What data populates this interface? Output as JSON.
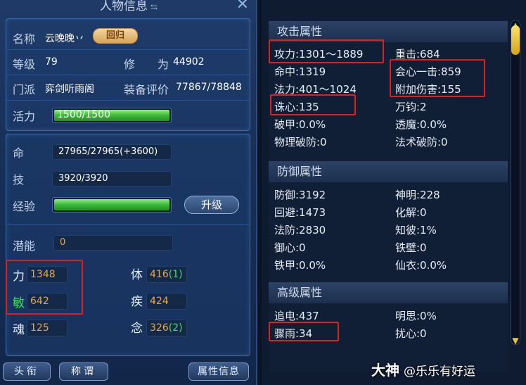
{
  "left": {
    "title": "人物信息",
    "name_label": "名称",
    "name_value": "云晚晚丷",
    "badge_text": "回归",
    "level_label": "等级",
    "level_value": "79",
    "cultivation_label": "修",
    "cultivation_label2": "为",
    "cultivation_value": "44902",
    "sect_label": "门派",
    "sect_value": "弈剑听雨阁",
    "rating_label": "装备评价",
    "rating_value": "77867/78848",
    "vitality_label": "活力",
    "vitality_value": "1500/1500",
    "vitality_fill": 1.0,
    "life_label": "命",
    "life_value": "27965/27965(+3600)",
    "skill_label": "技",
    "skill_value": "3920/3920",
    "exp_label": "经验",
    "exp_fill": 1.0,
    "upgrade_label": "升级",
    "potential_label": "潜能",
    "potential_value": "0",
    "attrs": {
      "li_label": "力",
      "li_value": "1348",
      "ti_label": "体",
      "ti_value": "416",
      "ti_bonus": "(1)",
      "min_label": "敏",
      "min_value": "642",
      "ji_label": "疾",
      "ji_value": "424",
      "hun_label": "魂",
      "hun_value": "125",
      "nian_label": "念",
      "nian_value": "326",
      "nian_bonus": "(2)"
    },
    "buttons": {
      "title_btn": "头衔",
      "appellation_btn": "称谓",
      "attr_info_btn": "属性信息"
    }
  },
  "right": {
    "attack_header": "攻击属性",
    "attack": {
      "atk": "攻力:1301～1889",
      "heavy": "重击:684",
      "hit": "命中:1319",
      "crit": "会心一击:859",
      "mag": "法力:401～1024",
      "extra_dmg": "附加伤害:155",
      "zhuxin": "诛心:135",
      "wanjun": "万钧:2",
      "pojia": "破甲:0.0%",
      "touomo": "透魔:0.0%",
      "phys_pen": "物理破防:0",
      "mag_pen": "法术破防:0"
    },
    "defense_header": "防御属性",
    "defense": {
      "def": "防御:3192",
      "shenming": "神明:228",
      "dodge": "回避:1473",
      "huajie": "化解:0",
      "mdef": "法防:2830",
      "zhibi": "知彼:1%",
      "yuxin": "御心:0",
      "tiebi": "铁壁:0",
      "tiejia": "铁甲:0.0%",
      "xianyi": "仙衣:0.0%"
    },
    "advanced_header": "高级属性",
    "advanced": {
      "zhuidian": "追电:437",
      "mingsi": "明思:0%",
      "zhouyu": "骤雨:34",
      "raoxin": "扰心:0"
    }
  },
  "watermark": {
    "brand": "大神",
    "user": "@乐乐有好运"
  },
  "colors": {
    "highlight_red": "#e0211b",
    "attr_orange": "#e6a54b",
    "bonus_green": "#44e05a",
    "bar_green": "#3cb83a"
  }
}
